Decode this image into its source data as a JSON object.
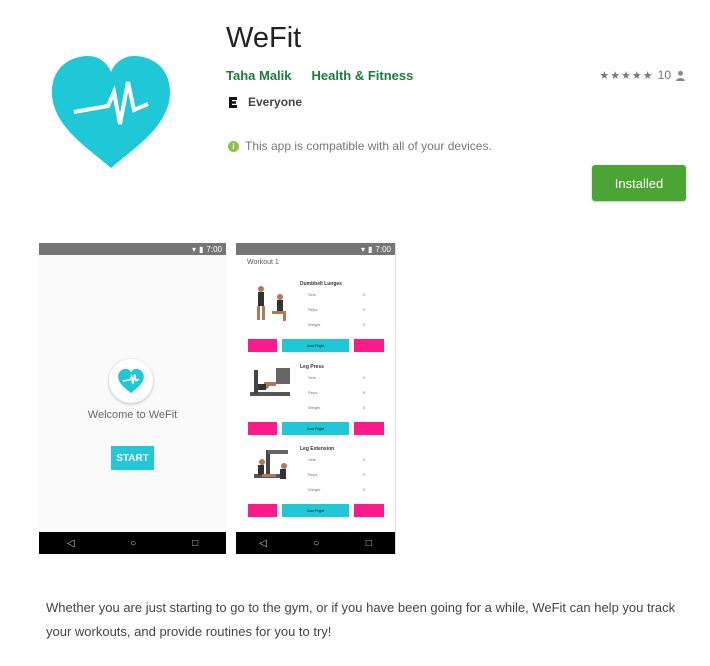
{
  "app": {
    "title": "WeFit",
    "developer": "Taha Malik",
    "category": "Health & Fitness",
    "rating_stars": "★★★★★",
    "rating_count": "10",
    "content_rating": "Everyone",
    "compatibility": "This app is compatible with all of your devices.",
    "install_label": "Installed",
    "accent_color": "#4aa535",
    "brand_color": "#1ec8d6"
  },
  "screenshot1": {
    "status_time": "7:00",
    "welcome": "Welcome to WeFit",
    "start_label": "START",
    "nav": [
      "◁",
      "○",
      "□"
    ]
  },
  "screenshot2": {
    "status_time": "7:00",
    "heading": "Workout 1",
    "exercises": [
      {
        "name": "Dumbbell Lunges",
        "fields": [
          "Sets",
          "Reps",
          "Weight"
        ],
        "values": [
          "0",
          "0",
          "0"
        ],
        "mid_button": "Just Right"
      },
      {
        "name": "Leg Press",
        "fields": [
          "Sets",
          "Reps",
          "Weight"
        ],
        "values": [
          "0",
          "0",
          "0"
        ],
        "mid_button": "Just Right"
      },
      {
        "name": "Leg Extension",
        "fields": [
          "Sets",
          "Reps",
          "Weight"
        ],
        "values": [
          "0",
          "0",
          "0"
        ],
        "mid_button": "Just Right"
      }
    ],
    "nav": [
      "◁",
      "○",
      "□"
    ]
  },
  "description": "Whether you are just starting to go to the gym, or if you have been going for a while, WeFit can help you track your workouts, and provide routines for you to try!"
}
